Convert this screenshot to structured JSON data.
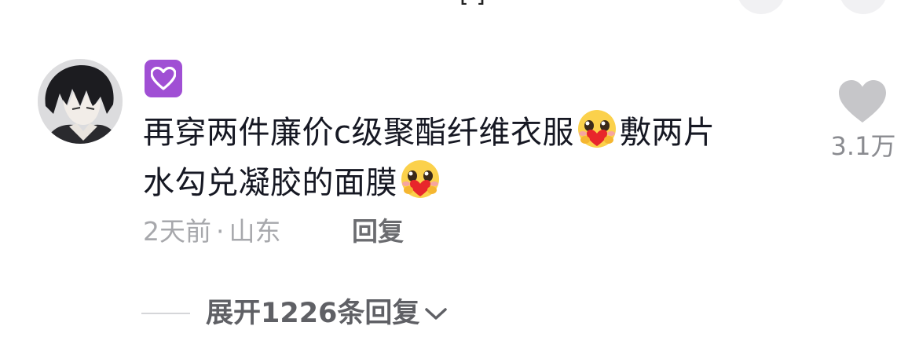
{
  "header": {
    "partial_title": "[  ]"
  },
  "comment": {
    "user_badge_icon": "purple-heart-icon",
    "text_line_1a": "再穿两件廉价c级聚酯纤维衣服",
    "text_line_1b": "敷两片",
    "text_line_2a": "水勾兑凝胶的面膜",
    "emoji_icon": "heart-hug-emoji",
    "time": "2天前",
    "separator": "·",
    "location": "山东",
    "reply_label": "回复",
    "like_count": "3.1万",
    "expand_label": "展开1226条回复"
  },
  "colors": {
    "badge": "#a04fd4",
    "text_primary": "#161823",
    "text_secondary": "#a7a8ac",
    "like_gray": "#c6c6c9"
  }
}
